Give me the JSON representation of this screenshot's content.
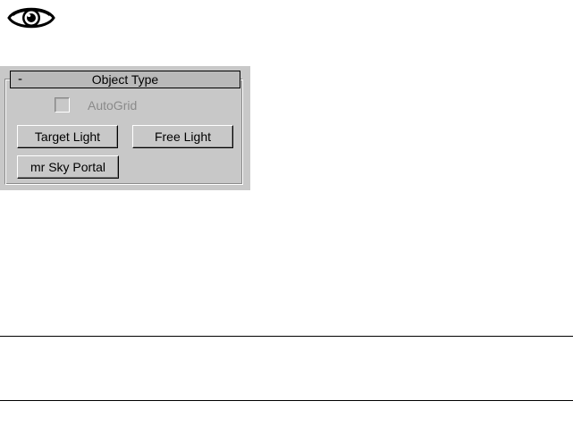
{
  "icons": {
    "eye": "eye-icon"
  },
  "rollout": {
    "toggle_symbol": "-",
    "title": "Object Type"
  },
  "autogrid": {
    "label": "AutoGrid",
    "checked": false,
    "enabled": false
  },
  "buttons": {
    "target_light": "Target Light",
    "free_light": "Free Light",
    "mr_sky_portal": "mr Sky Portal"
  },
  "colors": {
    "panel_background": "#c8c8c8",
    "header_background": "#b9b9b9",
    "disabled_text": "#8a8a8a"
  }
}
